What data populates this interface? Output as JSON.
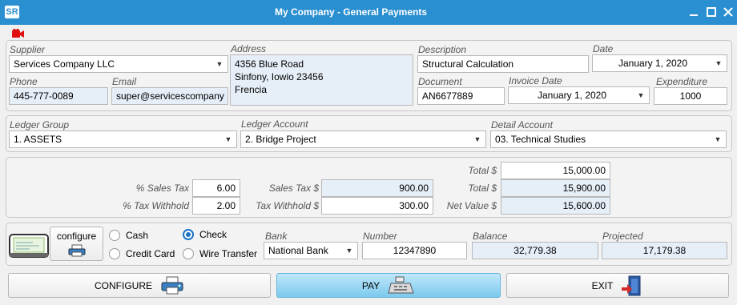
{
  "window": {
    "logo": "SR",
    "title": "My Company - General Payments"
  },
  "supplier_section": {
    "supplier": {
      "label": "Supplier",
      "value": "Services Company LLC"
    },
    "address": {
      "label": "Address",
      "lines": [
        "4356 Blue Road",
        "Sinfony, Iowio 23456",
        "Frencia"
      ]
    },
    "description": {
      "label": "Description",
      "value": "Structural Calculation"
    },
    "date": {
      "label": "Date",
      "value": "January 1, 2020"
    },
    "phone": {
      "label": "Phone",
      "value": "445-777-0089"
    },
    "email": {
      "label": "Email",
      "value": "super@servicescompany"
    },
    "document": {
      "label": "Document",
      "value": "AN6677889"
    },
    "invoice_date": {
      "label": "Invoice Date",
      "value": "January 1, 2020"
    },
    "expenditure": {
      "label": "Expenditure",
      "value": "1000"
    }
  },
  "ledger_section": {
    "ledger_group": {
      "label": "Ledger Group",
      "value": "1. ASSETS"
    },
    "ledger_account": {
      "label": "Ledger Account",
      "value": "2. Bridge Project"
    },
    "detail_account": {
      "label": "Detail Account",
      "value": "03. Technical Studies"
    }
  },
  "totals_section": {
    "total_top": {
      "label": "Total $",
      "value": "15,000.00"
    },
    "sales_tax_pct": {
      "label": "% Sales Tax",
      "value": "6.00"
    },
    "sales_tax_amt": {
      "label": "Sales Tax $",
      "value": "900.00"
    },
    "total_mid": {
      "label": "Total $",
      "value": "15,900.00"
    },
    "tax_withhold_pct": {
      "label": "% Tax Withhold",
      "value": "2.00"
    },
    "tax_withhold_amt": {
      "label": "Tax Withhold $",
      "value": "300.00"
    },
    "net_value": {
      "label": "Net Value $",
      "value": "15,600.00"
    }
  },
  "payment_section": {
    "configure_label": "configure",
    "methods": [
      {
        "label": "Cash",
        "selected": false
      },
      {
        "label": "Check",
        "selected": true
      },
      {
        "label": "Credit Card",
        "selected": false
      },
      {
        "label": "Wire Transfer",
        "selected": false
      }
    ],
    "bank": {
      "label": "Bank",
      "value": "National Bank"
    },
    "number": {
      "label": "Number",
      "value": "12347890"
    },
    "balance": {
      "label": "Balance",
      "value": "32,779.38"
    },
    "projected": {
      "label": "Projected",
      "value": "17,179.38"
    }
  },
  "buttons": {
    "configure": "CONFIGURE",
    "pay": "PAY",
    "exit": "EXIT"
  },
  "colors": {
    "titlebar": "#2a8fd0",
    "readonly_field": "#e6eef7",
    "pay_button": "#7cc9ee",
    "radio_selected": "#1a73c8"
  }
}
